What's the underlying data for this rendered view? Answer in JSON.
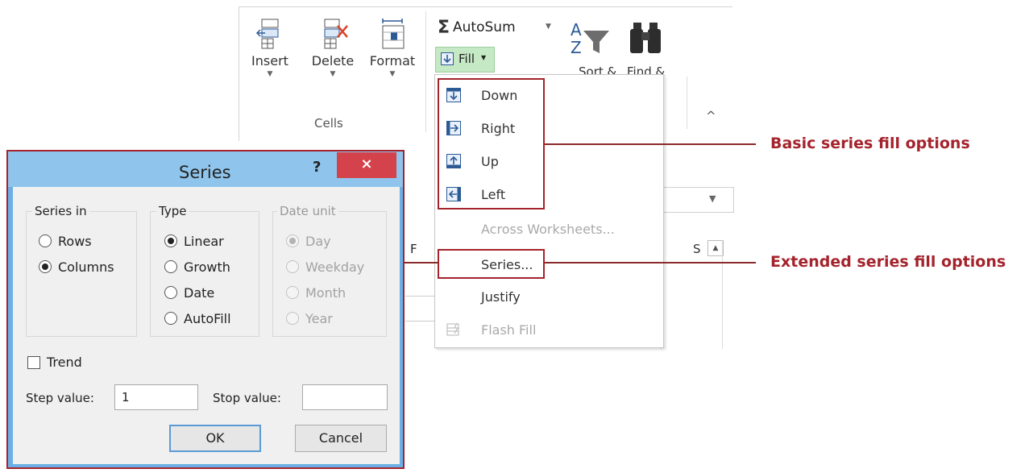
{
  "ribbon": {
    "insert_label": "Insert",
    "delete_label": "Delete",
    "format_label": "Format",
    "group_label": "Cells",
    "autosum_label": "AutoSum",
    "fill_label": "Fill",
    "sort_label": "Sort &",
    "find_label": "Find &"
  },
  "fill_menu": {
    "items": [
      {
        "label": "Down",
        "icon": "fill-down-icon"
      },
      {
        "label": "Right",
        "icon": "fill-right-icon"
      },
      {
        "label": "Up",
        "icon": "fill-up-icon"
      },
      {
        "label": "Left",
        "icon": "fill-left-icon"
      },
      {
        "label": "Across Worksheets...",
        "disabled": true
      },
      {
        "label": "Series..."
      },
      {
        "label": "Justify"
      },
      {
        "label": "Flash Fill",
        "disabled": true,
        "icon": "flash-fill-icon"
      }
    ]
  },
  "sheet": {
    "col_f": "F",
    "col_s": "S"
  },
  "callouts": {
    "basic": "Basic series fill options",
    "extended": "Extended series fill options"
  },
  "dialog": {
    "title": "Series",
    "help": "?",
    "close": "×",
    "series_in": {
      "title": "Series in",
      "options": [
        "Rows",
        "Columns"
      ],
      "selected": "Columns"
    },
    "type": {
      "title": "Type",
      "options": [
        "Linear",
        "Growth",
        "Date",
        "AutoFill"
      ],
      "selected": "Linear"
    },
    "date_unit": {
      "title": "Date unit",
      "options": [
        "Day",
        "Weekday",
        "Month",
        "Year"
      ],
      "selected": "Day"
    },
    "trend_label": "Trend",
    "step_label": "Step value:",
    "step_value": "1",
    "stop_label": "Stop value:",
    "stop_value": "",
    "ok": "OK",
    "cancel": "Cancel"
  },
  "colors": {
    "callout_red": "#a4232c",
    "dialog_title_blue": "#8fc5ec",
    "close_red": "#d4434b",
    "fill_green": "#c5e8c5"
  }
}
